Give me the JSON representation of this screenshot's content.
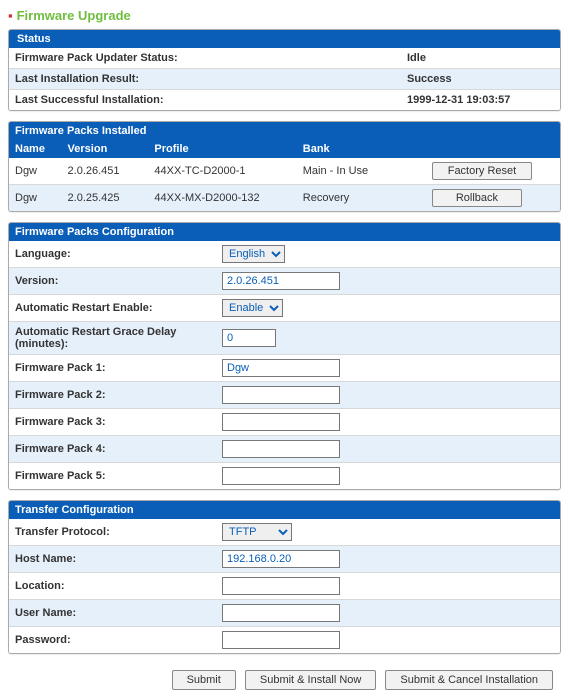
{
  "pageTitle": "Firmware Upgrade",
  "status": {
    "header": "Status",
    "rows": [
      {
        "label": "Firmware Pack Updater Status:",
        "value": "Idle"
      },
      {
        "label": "Last Installation Result:",
        "value": "Success"
      },
      {
        "label": "Last Successful Installation:",
        "value": "1999-12-31 19:03:57"
      }
    ]
  },
  "packsInstalled": {
    "header": "Firmware Packs Installed",
    "columns": {
      "name": "Name",
      "version": "Version",
      "profile": "Profile",
      "bank": "Bank"
    },
    "rows": [
      {
        "name": "Dgw",
        "version": "2.0.26.451",
        "profile": "44XX-TC-D2000-1",
        "bank": "Main - In Use",
        "action": "Factory Reset"
      },
      {
        "name": "Dgw",
        "version": "2.0.25.425",
        "profile": "44XX-MX-D2000-132",
        "bank": "Recovery",
        "action": "Rollback"
      }
    ]
  },
  "packsConfig": {
    "header": "Firmware Packs Configuration",
    "language": {
      "label": "Language:",
      "options": [
        "English"
      ],
      "value": "English"
    },
    "version": {
      "label": "Version:",
      "value": "2.0.26.451"
    },
    "autoRestart": {
      "label": "Automatic Restart Enable:",
      "options": [
        "Enable"
      ],
      "value": "Enable"
    },
    "graceDelay": {
      "label": "Automatic Restart Grace Delay (minutes):",
      "value": "0"
    },
    "pack1": {
      "label": "Firmware Pack 1:",
      "value": "Dgw"
    },
    "pack2": {
      "label": "Firmware Pack 2:",
      "value": ""
    },
    "pack3": {
      "label": "Firmware Pack 3:",
      "value": ""
    },
    "pack4": {
      "label": "Firmware Pack 4:",
      "value": ""
    },
    "pack5": {
      "label": "Firmware Pack 5:",
      "value": ""
    }
  },
  "transfer": {
    "header": "Transfer Configuration",
    "protocol": {
      "label": "Transfer Protocol:",
      "options": [
        "TFTP"
      ],
      "value": "TFTP"
    },
    "host": {
      "label": "Host Name:",
      "value": "192.168.0.20"
    },
    "location": {
      "label": "Location:",
      "value": ""
    },
    "username": {
      "label": "User Name:",
      "value": ""
    },
    "password": {
      "label": "Password:",
      "value": ""
    }
  },
  "actions": {
    "submit": "Submit",
    "submitInstall": "Submit & Install Now",
    "submitCancel": "Submit & Cancel Installation"
  }
}
